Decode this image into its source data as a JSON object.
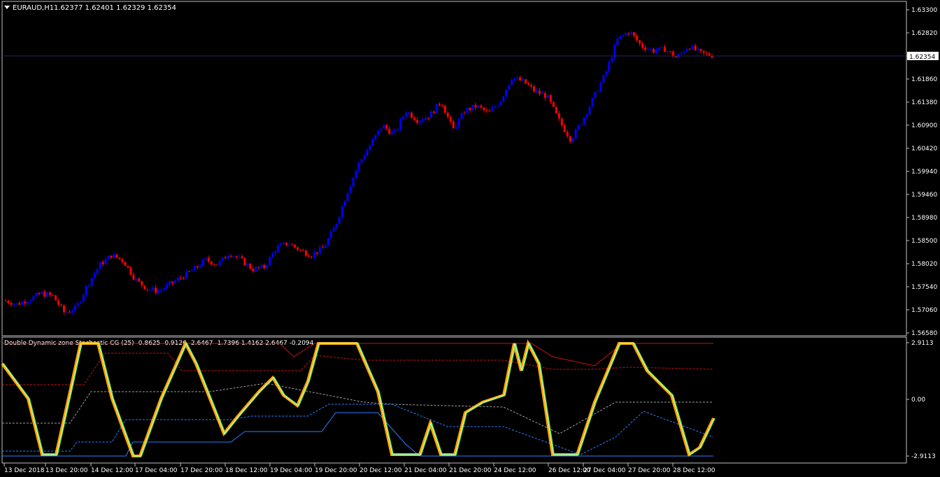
{
  "main_panel": {
    "symbol_label": "EURAUD,H1",
    "ohlc": "1.62377 1.62401 1.62329 1.62354",
    "current_price": "1.62354",
    "price_ticks": [
      "1.63300",
      "1.62820",
      "1.62340",
      "1.61860",
      "1.61380",
      "1.60900",
      "1.60420",
      "1.59940",
      "1.59460",
      "1.58980",
      "1.58500",
      "1.58020",
      "1.57540",
      "1.57060",
      "1.56580"
    ]
  },
  "sub_panel": {
    "indicator_label": "Double Dynamic zone Stochastic CG (25) -0.8625 -0.9126 -2.6467 -1.7396 1.4162 2.6467 -0.2094",
    "ticks": [
      "2.9113",
      "0.00",
      "-2.9113"
    ]
  },
  "time_axis": {
    "labels": [
      "13 Dec 2018",
      "13 Dec 20:00",
      "14 Dec 12:00",
      "17 Dec 04:00",
      "17 Dec 20:00",
      "18 Dec 12:00",
      "19 Dec 04:00",
      "19 Dec 20:00",
      "20 Dec 12:00",
      "21 Dec 04:00",
      "21 Dec 20:00",
      "24 Dec 12:00",
      "26 Dec 12:00",
      "27 Dec 04:00",
      "27 Dec 20:00",
      "28 Dec 12:00"
    ]
  },
  "colors": {
    "bull": "#0000ff",
    "bear": "#ff0000",
    "frame": "#c0c0c0",
    "text": "#ffffff",
    "price_line": "#25255a",
    "osc_green": "#6fe04a",
    "osc_orange": "#ffa500",
    "level_red": "#d01010",
    "level_blue": "#2a7fff",
    "level_gray": "#a0a0a0"
  },
  "chart_data": {
    "type": "candlestick",
    "symbol": "EURAUD",
    "timeframe": "H1",
    "ylim": [
      1.5658,
      1.633
    ],
    "close_path": [
      1.5725,
      1.5718,
      1.5728,
      1.574,
      1.5735,
      1.57,
      1.571,
      1.576,
      1.58,
      1.582,
      1.5808,
      1.577,
      1.575,
      1.5745,
      1.576,
      1.5775,
      1.579,
      1.581,
      1.58,
      1.5825,
      1.581,
      1.579,
      1.5795,
      1.5835,
      1.5845,
      1.583,
      1.582,
      1.5835,
      1.588,
      1.595,
      1.601,
      1.605,
      1.609,
      1.607,
      1.612,
      1.61,
      1.611,
      1.614,
      1.608,
      1.612,
      1.613,
      1.6115,
      1.614,
      1.619,
      1.618,
      1.616,
      1.615,
      1.61,
      1.606,
      1.61,
      1.615,
      1.62,
      1.627,
      1.6285,
      1.6255,
      1.6245,
      1.6248,
      1.623,
      1.6255,
      1.624,
      1.6235
    ]
  }
}
